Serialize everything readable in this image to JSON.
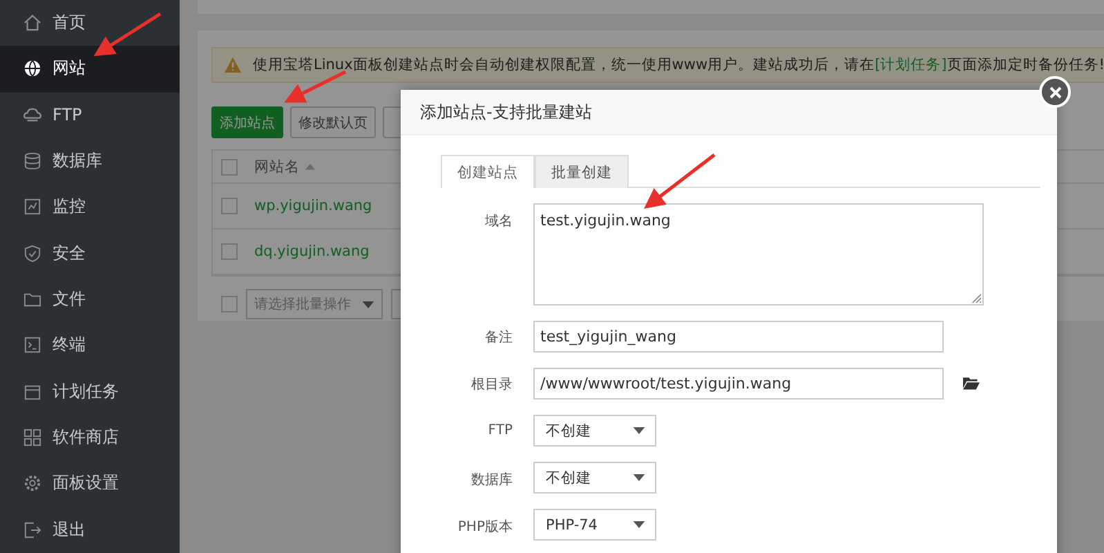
{
  "sidebar": {
    "items": [
      {
        "label": "首页",
        "selected": false
      },
      {
        "label": "网站",
        "selected": true
      },
      {
        "label": "FTP",
        "selected": false
      },
      {
        "label": "数据库",
        "selected": false
      },
      {
        "label": "监控",
        "selected": false
      },
      {
        "label": "安全",
        "selected": false
      },
      {
        "label": "文件",
        "selected": false
      },
      {
        "label": "终端",
        "selected": false
      },
      {
        "label": "计划任务",
        "selected": false
      },
      {
        "label": "软件商店",
        "selected": false
      },
      {
        "label": "面板设置",
        "selected": false
      },
      {
        "label": "退出",
        "selected": false
      }
    ]
  },
  "notice": {
    "before": "使用宝塔Linux面板创建站点时会自动创建权限配置，统一使用www用户。建站成功后，请在",
    "link": "[计划任务]",
    "after": "页面添加定时备份任务!"
  },
  "toolbar": {
    "buttons": [
      {
        "kind": "primary",
        "label": "添加站点"
      },
      {
        "kind": "default",
        "label": "修改默认页"
      },
      {
        "kind": "cut"
      }
    ]
  },
  "table": {
    "header": {
      "checked": false,
      "label": "网站名",
      "sorted": true
    },
    "rows": [
      {
        "name": "wp.yigujin.wang",
        "checked": false
      },
      {
        "name": "dq.yigujin.wang",
        "checked": false
      }
    ]
  },
  "batch": {
    "checked": false,
    "placeholder": "请选择批量操作"
  },
  "modal": {
    "title": "添加站点-支持批量建站",
    "tabs": [
      {
        "label": "创建站点",
        "selected": true
      },
      {
        "label": "批量创建",
        "selected": false
      }
    ],
    "fields": [
      {
        "kind": "textarea",
        "label": "域名",
        "value": "test.yigujin.wang"
      },
      {
        "kind": "input",
        "label": "备注",
        "value": "test_yigujin_wang"
      },
      {
        "kind": "path",
        "label": "根目录",
        "value": "/www/wwwroot/test.yigujin.wang"
      },
      {
        "kind": "select",
        "label": "FTP",
        "value": "不创建"
      },
      {
        "kind": "select",
        "label": "数据库",
        "value": "不创建"
      },
      {
        "kind": "select",
        "label": "PHP版本",
        "value": "PHP-74"
      }
    ]
  }
}
